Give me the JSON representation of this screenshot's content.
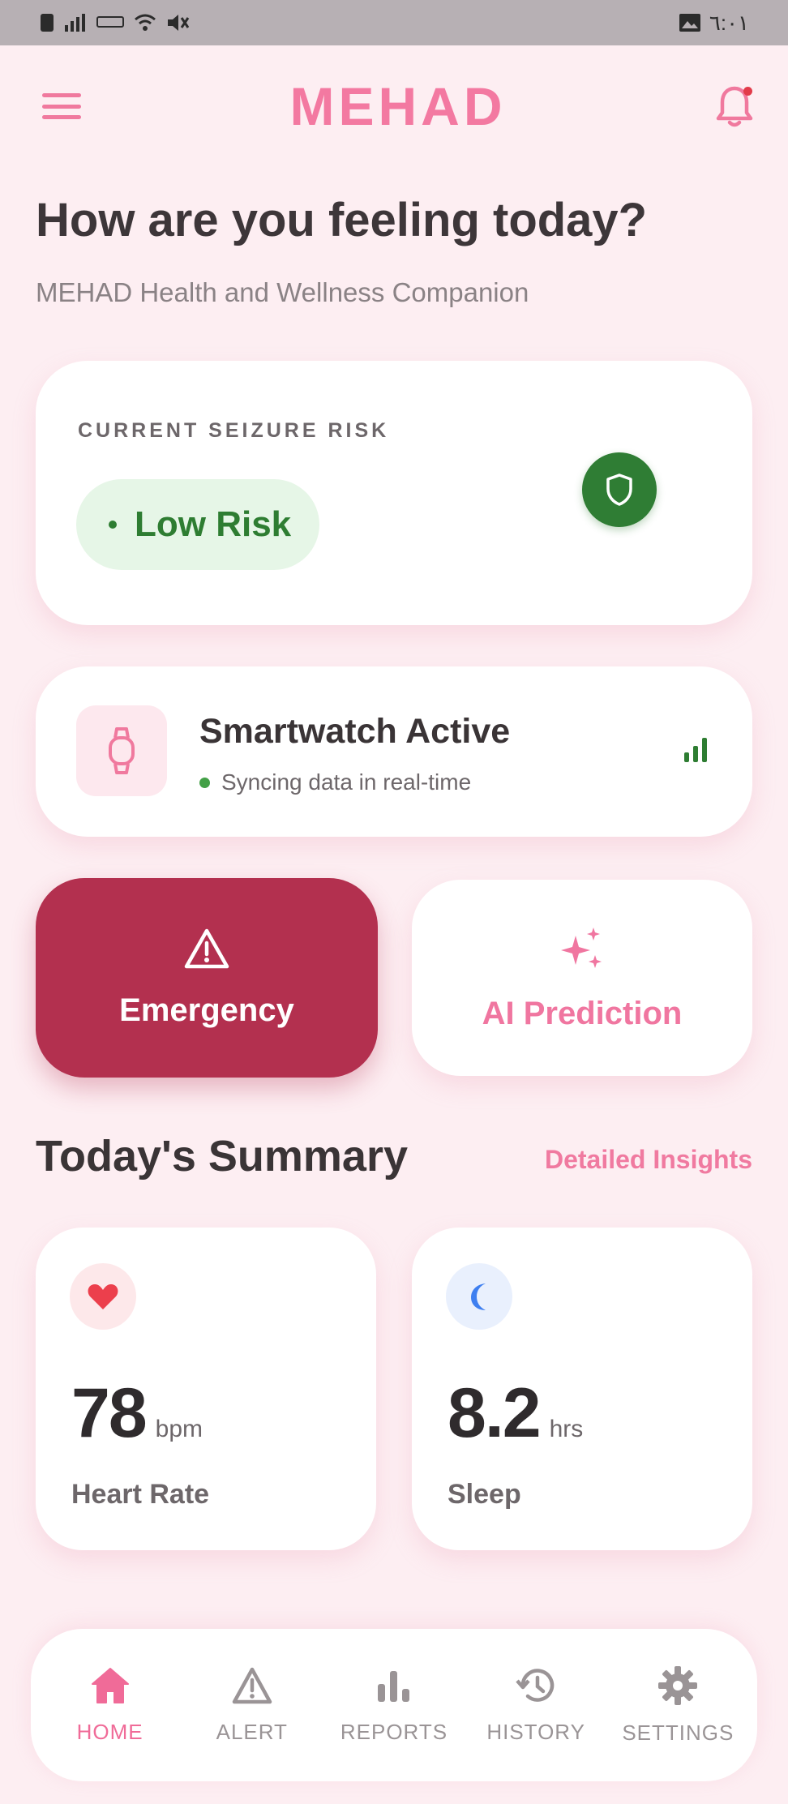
{
  "status_bar": {
    "time": "٦:٠١"
  },
  "header": {
    "brand": "MEHAD"
  },
  "greeting": {
    "title": "How are you feeling today?",
    "subtitle": "MEHAD Health and Wellness Companion"
  },
  "risk": {
    "label": "CURRENT SEIZURE RISK",
    "level": "Low Risk"
  },
  "device": {
    "title": "Smartwatch Active",
    "status": "Syncing data in real-time"
  },
  "actions": {
    "emergency": "Emergency",
    "ai_prediction": "AI Prediction"
  },
  "summary": {
    "title": "Today's Summary",
    "link": "Detailed Insights",
    "heart_rate": {
      "value": "78",
      "unit": "bpm",
      "label": "Heart Rate"
    },
    "sleep": {
      "value": "8.2",
      "unit": "hrs",
      "label": "Sleep"
    }
  },
  "nav": {
    "items": [
      {
        "label": "HOME",
        "icon": "home-icon",
        "active": true
      },
      {
        "label": "ALERT",
        "icon": "alert-icon",
        "active": false
      },
      {
        "label": "REPORTS",
        "icon": "bar-chart-icon",
        "active": false
      },
      {
        "label": "HISTORY",
        "icon": "history-icon",
        "active": false
      },
      {
        "label": "SETTINGS",
        "icon": "gear-icon",
        "active": false
      }
    ]
  },
  "colors": {
    "brand_pink": "#f379a1",
    "emergency_red": "#b3304f",
    "risk_green": "#2e7d32",
    "background": "#fdeef2"
  }
}
